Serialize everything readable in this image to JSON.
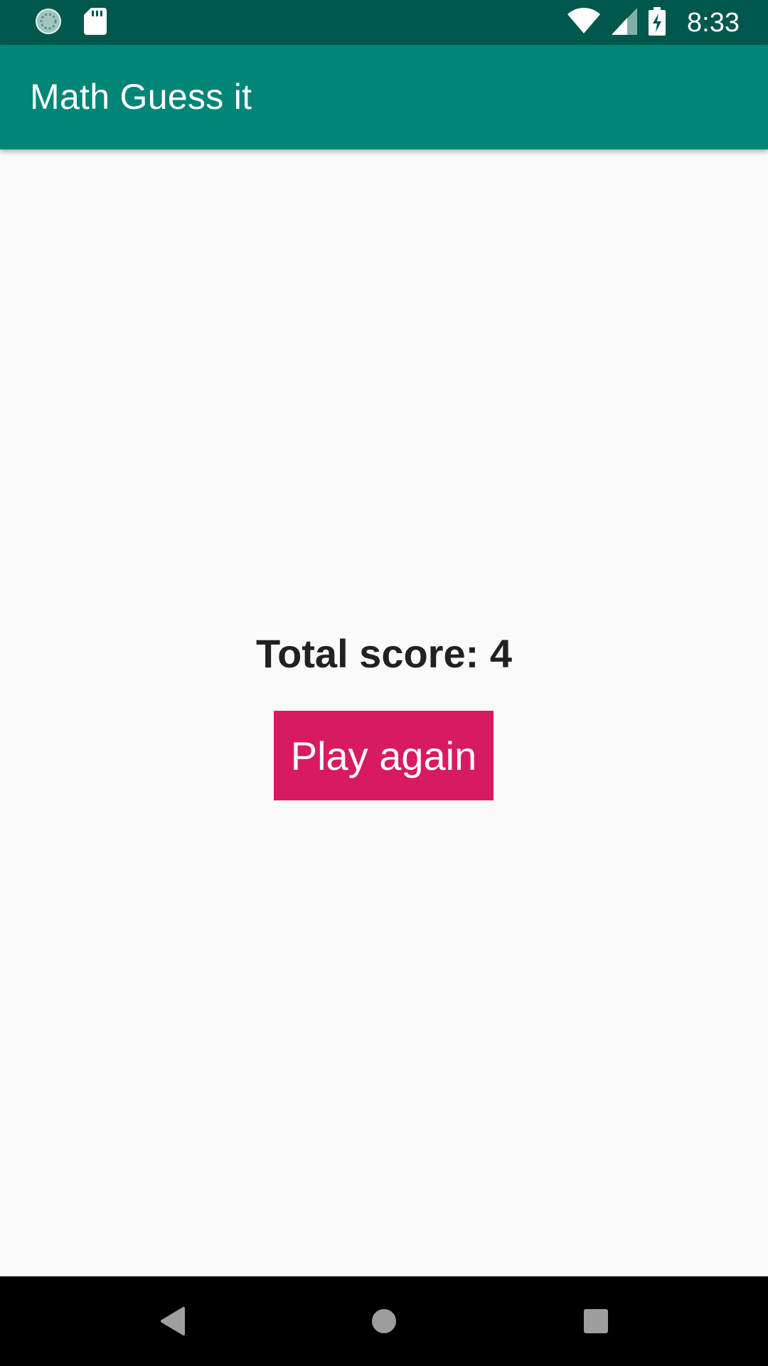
{
  "status_bar": {
    "time": "8:33",
    "icons": {
      "left": [
        "sync-circle-icon",
        "sd-card-icon"
      ],
      "right": [
        "wifi-icon",
        "cell-signal-icon",
        "battery-charging-icon"
      ]
    },
    "background": "#00574b"
  },
  "app_bar": {
    "title": "Math Guess it",
    "background": "#008577"
  },
  "main": {
    "score_text": "Total score: 4",
    "play_again_label": "Play again",
    "button_color": "#d81b60"
  },
  "nav_bar": {
    "icons": [
      "back-icon",
      "home-icon",
      "recents-icon"
    ]
  }
}
